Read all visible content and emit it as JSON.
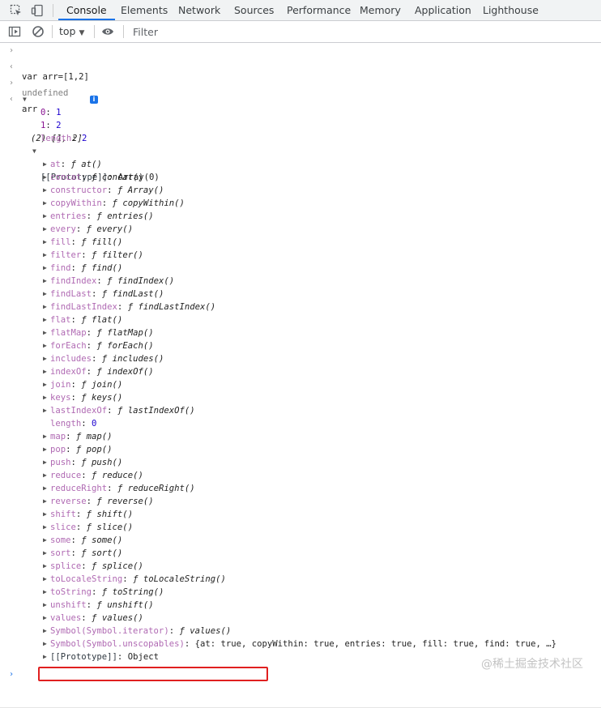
{
  "tabs": [
    "Console",
    "Elements",
    "Network",
    "Sources",
    "Performance",
    "Memory",
    "Application",
    "Lighthouse"
  ],
  "toolbar": {
    "context": "top",
    "filter_placeholder": "Filter"
  },
  "console": {
    "input1": "var arr=[1,2]",
    "result1": "undefined",
    "input2": "arr",
    "array_summary": "(2) [1, 2]",
    "info_badge": "i",
    "entries": [
      {
        "key": "0",
        "value": "1"
      },
      {
        "key": "1",
        "value": "2"
      },
      {
        "key": "length",
        "value": "2"
      }
    ],
    "prototype_label": "[[Prototype]]",
    "prototype_value": "Array(0)",
    "methods": [
      {
        "key": "at",
        "value": "at()"
      },
      {
        "key": "concat",
        "value": "concat()"
      },
      {
        "key": "constructor",
        "value": "Array()"
      },
      {
        "key": "copyWithin",
        "value": "copyWithin()"
      },
      {
        "key": "entries",
        "value": "entries()"
      },
      {
        "key": "every",
        "value": "every()"
      },
      {
        "key": "fill",
        "value": "fill()"
      },
      {
        "key": "filter",
        "value": "filter()"
      },
      {
        "key": "find",
        "value": "find()"
      },
      {
        "key": "findIndex",
        "value": "findIndex()"
      },
      {
        "key": "findLast",
        "value": "findLast()"
      },
      {
        "key": "findLastIndex",
        "value": "findLastIndex()"
      },
      {
        "key": "flat",
        "value": "flat()"
      },
      {
        "key": "flatMap",
        "value": "flatMap()"
      },
      {
        "key": "forEach",
        "value": "forEach()"
      },
      {
        "key": "includes",
        "value": "includes()"
      },
      {
        "key": "indexOf",
        "value": "indexOf()"
      },
      {
        "key": "join",
        "value": "join()"
      },
      {
        "key": "keys",
        "value": "keys()"
      },
      {
        "key": "lastIndexOf",
        "value": "lastIndexOf()"
      },
      {
        "key": "length",
        "value": "0",
        "plain": true
      },
      {
        "key": "map",
        "value": "map()"
      },
      {
        "key": "pop",
        "value": "pop()"
      },
      {
        "key": "push",
        "value": "push()"
      },
      {
        "key": "reduce",
        "value": "reduce()"
      },
      {
        "key": "reduceRight",
        "value": "reduceRight()"
      },
      {
        "key": "reverse",
        "value": "reverse()"
      },
      {
        "key": "shift",
        "value": "shift()"
      },
      {
        "key": "slice",
        "value": "slice()"
      },
      {
        "key": "some",
        "value": "some()"
      },
      {
        "key": "sort",
        "value": "sort()"
      },
      {
        "key": "splice",
        "value": "splice()"
      },
      {
        "key": "toLocaleString",
        "value": "toLocaleString()"
      },
      {
        "key": "toString",
        "value": "toString()"
      },
      {
        "key": "unshift",
        "value": "unshift()"
      },
      {
        "key": "values",
        "value": "values()"
      },
      {
        "key": "Symbol(Symbol.iterator)",
        "value": "values()",
        "highlight": true
      },
      {
        "key": "Symbol(Symbol.unscopables)",
        "value": "{at: true, copyWithin: true, entries: true, fill: true, find: true, …}",
        "object": true
      },
      {
        "key": "[[Prototype]]",
        "value": "Object",
        "object": true,
        "dark": true
      }
    ]
  },
  "watermark": "@稀土掘金技术社区"
}
